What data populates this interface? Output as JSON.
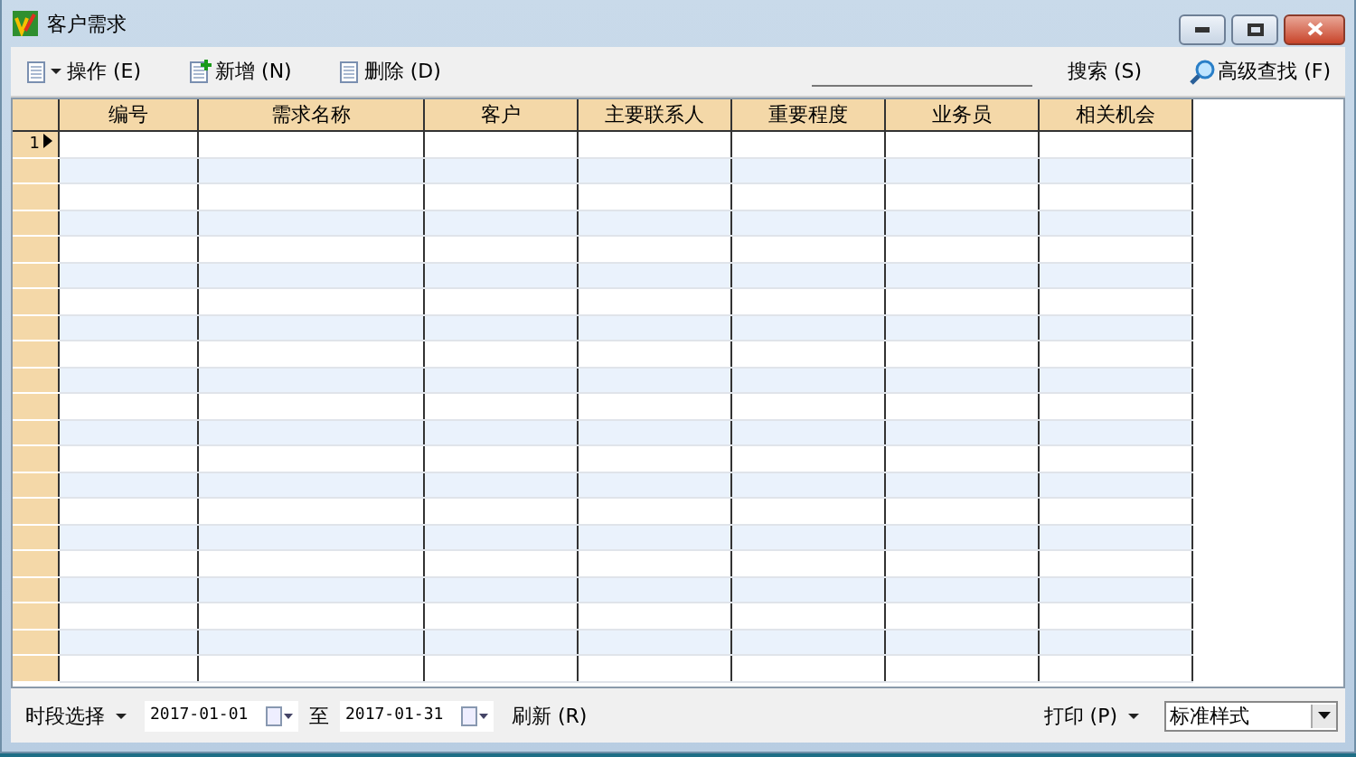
{
  "window": {
    "title": "客户需求"
  },
  "toolbar": [
    {
      "kind": "menu",
      "label": "操作",
      "shortcut": "(E)"
    },
    {
      "kind": "new",
      "label": "新增",
      "shortcut": "(N)"
    },
    {
      "kind": "delete",
      "label": "删除",
      "shortcut": "(D)"
    }
  ],
  "search": {
    "label": "搜索",
    "shortcut": "(S)",
    "advanced": {
      "label": "高级查找",
      "shortcut": "(F)"
    }
  },
  "grid": {
    "columns": [
      "编号",
      "需求名称",
      "客户",
      "主要联系人",
      "重要程度",
      "业务员",
      "相关机会"
    ],
    "current_row_label": "1"
  },
  "footer": {
    "period": {
      "label": "时段选择"
    },
    "from": "2017-01-01",
    "to_label": "至",
    "to": "2017-01-31",
    "refresh": {
      "label": "刷新",
      "shortcut": "(R)"
    },
    "print": {
      "label": "打印",
      "shortcut": "(P)"
    },
    "style": "标准样式"
  }
}
